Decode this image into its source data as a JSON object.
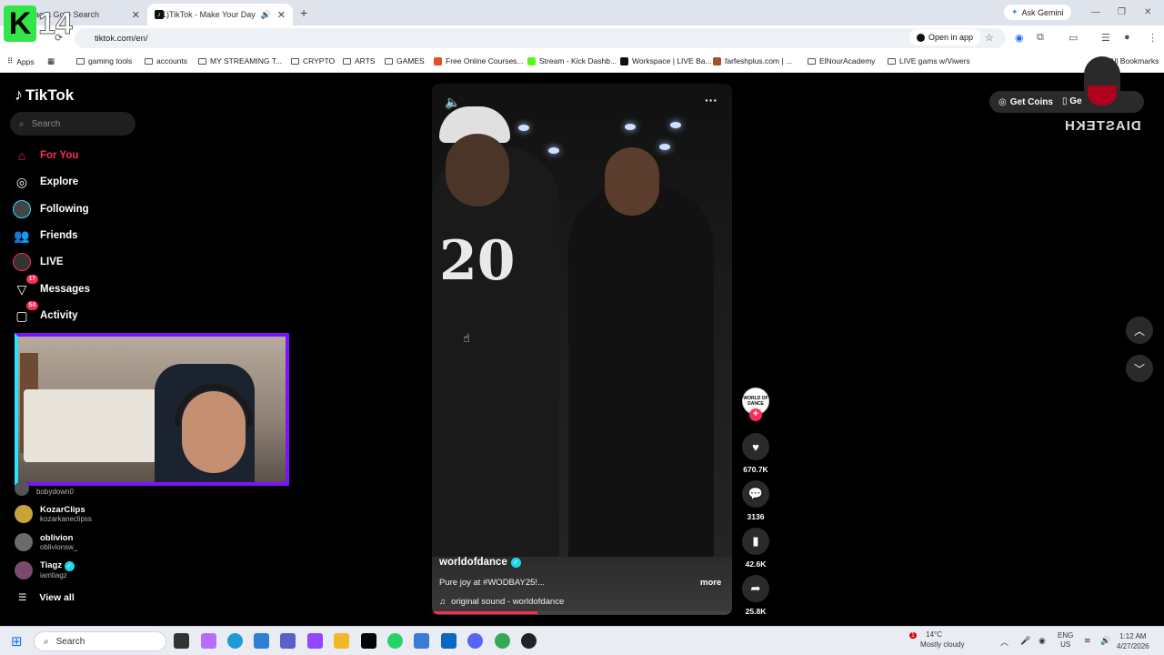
{
  "browser": {
    "tabs": [
      {
        "title": "Instagram - Google Search",
        "title_visible": "agra   Go   e Search"
      },
      {
        "title": "(71)TikTok - Make Your Day"
      }
    ],
    "ask_gemini": "Ask Gemini",
    "url": "tiktok.com/en/",
    "open_in_app": "Open in app",
    "bookmarks": [
      "Apps",
      "gaming tools",
      "accounts",
      "MY STREAMING T...",
      "CRYPTO",
      "ARTS",
      "GAMES",
      "Free Online Courses...",
      "Stream - Kick Dashb...",
      "Workspace | LIVE Ba...",
      "farfeshplus.com | ...",
      "ElNourAcademy",
      "LIVE gams w/Viwers"
    ],
    "all_bookmarks": "All Bookmarks"
  },
  "overlay": {
    "channel_number": "14",
    "channel_letter": "K",
    "streamer_name": "DIASTEKH"
  },
  "tiktok": {
    "logo": "TikTok",
    "search_placeholder": "Search",
    "menu": [
      {
        "label": "For You",
        "icon": "home-icon",
        "active": true
      },
      {
        "label": "Explore",
        "icon": "compass-icon"
      },
      {
        "label": "Following",
        "icon": "following-icon"
      },
      {
        "label": "Friends",
        "icon": "friends-icon"
      },
      {
        "label": "LIVE",
        "icon": "live-icon"
      },
      {
        "label": "Messages",
        "icon": "messages-icon",
        "badge": "17"
      },
      {
        "label": "Activity",
        "icon": "activity-icon",
        "badge": "54"
      }
    ],
    "following_accounts": [
      {
        "name": "",
        "handle": "bobydown0"
      },
      {
        "name": "KozarClips",
        "handle": "kozarkaneclipss"
      },
      {
        "name": "oblivion",
        "handle": "oblivionsw_"
      },
      {
        "name": "Tiagz",
        "handle": "iamtiagz",
        "verified": true
      }
    ],
    "view_all": "View all",
    "get_coins": "Get Coins",
    "get_app": "Ge",
    "video": {
      "author": "worldofdance",
      "verified": true,
      "description": "Pure joy at #WODBAY25!...",
      "more": "more",
      "sound": "original sound - worldofdance",
      "progress_fraction": 0.35,
      "shirt_text": "20",
      "avatar_text": "WORLD OF DANCE"
    },
    "actions": {
      "likes": "670.7K",
      "comments": "3136",
      "saves": "42.6K",
      "shares": "25.8K"
    }
  },
  "taskbar": {
    "search": "Search",
    "weather_temp": "14°C",
    "weather_desc": "Mostly cloudy",
    "weather_badge": "1",
    "lang": "ENG",
    "region": "US",
    "time": "1:12 AM",
    "date": "4/27/2026"
  },
  "colors": {
    "accent": "#fe2c55",
    "verified": "#20d5ec",
    "webcam_border": "#7d12ff",
    "k_logo": "#32e64a"
  }
}
